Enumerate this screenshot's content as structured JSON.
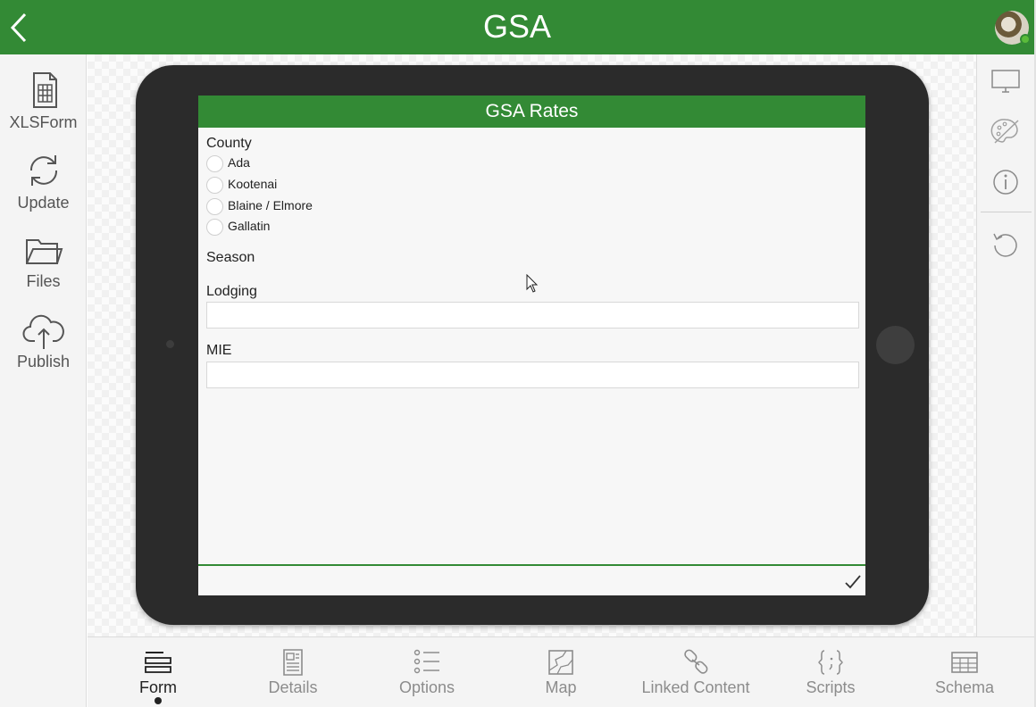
{
  "header": {
    "title": "GSA"
  },
  "sidebar": {
    "items": [
      {
        "label": "XLSForm",
        "icon": "spreadsheet-file-icon"
      },
      {
        "label": "Update",
        "icon": "refresh-icon"
      },
      {
        "label": "Files",
        "icon": "folder-icon"
      },
      {
        "label": "Publish",
        "icon": "cloud-upload-icon"
      }
    ]
  },
  "rightbar": {
    "icons": [
      "monitor-icon",
      "palette-disabled-icon",
      "info-icon",
      "reset-icon"
    ]
  },
  "form": {
    "title": "GSA Rates",
    "county": {
      "label": "County",
      "options": [
        "Ada",
        "Kootenai",
        "Blaine / Elmore",
        "Gallatin"
      ]
    },
    "season": {
      "label": "Season"
    },
    "lodging": {
      "label": "Lodging",
      "value": ""
    },
    "mie": {
      "label": "MIE",
      "value": ""
    }
  },
  "tabs": [
    {
      "label": "Form",
      "icon": "form-icon",
      "active": true
    },
    {
      "label": "Details",
      "icon": "details-icon",
      "active": false
    },
    {
      "label": "Options",
      "icon": "options-list-icon",
      "active": false
    },
    {
      "label": "Map",
      "icon": "map-icon",
      "active": false
    },
    {
      "label": "Linked Content",
      "icon": "link-icon",
      "active": false
    },
    {
      "label": "Scripts",
      "icon": "scripts-braces-icon",
      "active": false
    },
    {
      "label": "Schema",
      "icon": "schema-table-icon",
      "active": false
    }
  ],
  "colors": {
    "brand_green": "#338a35",
    "device_body": "#2b2b2b",
    "sidebar_bg": "#f4f4f4"
  }
}
